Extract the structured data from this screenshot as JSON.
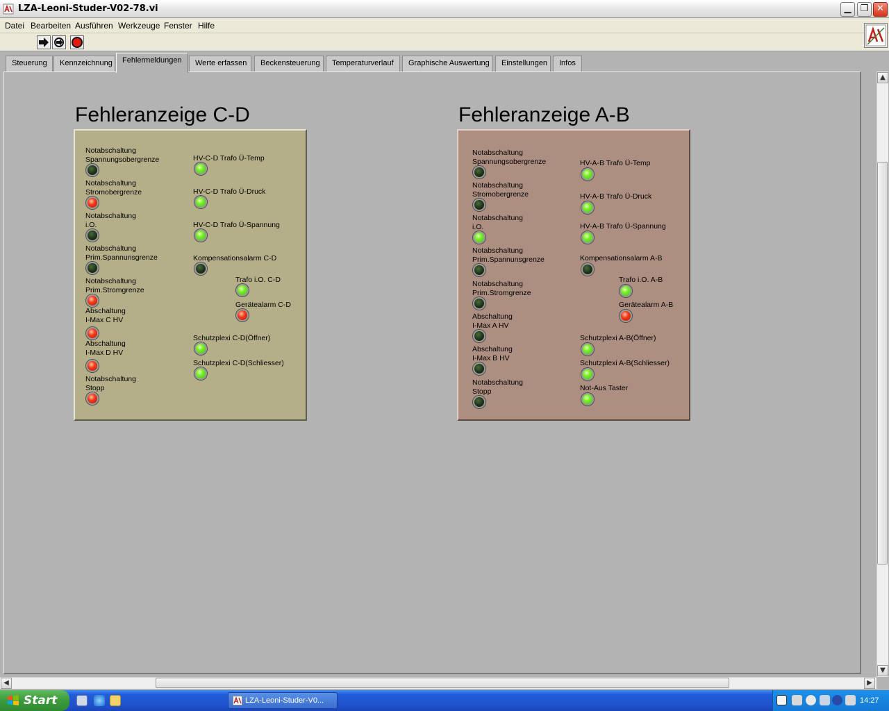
{
  "window": {
    "title": "LZA-Leoni-Studer-V02-78.vi",
    "controls": [
      "minimize",
      "maximize",
      "close"
    ]
  },
  "menu": [
    "Datei",
    "Bearbeiten",
    "Ausführen",
    "Werkzeuge",
    "Fenster",
    "Hilfe"
  ],
  "toolbar": {
    "buttons": [
      "run-arrow-icon",
      "run-continuously-icon",
      "abort-stop-icon"
    ]
  },
  "tabs": [
    {
      "label": "Steuerung",
      "active": false
    },
    {
      "label": "Kennzeichnung",
      "active": false
    },
    {
      "label": "Fehlermeldungen",
      "active": true
    },
    {
      "label": "Werte erfassen",
      "active": false
    },
    {
      "label": "Beckensteuerung",
      "active": false
    },
    {
      "label": "Temperaturverlauf",
      "active": false
    },
    {
      "label": "Graphische Auswertung",
      "active": false
    },
    {
      "label": "Einstellungen",
      "active": false
    },
    {
      "label": "Infos",
      "active": false
    }
  ],
  "panel_cd": {
    "title": "Fehleranzeige C-D",
    "left": [
      {
        "label": "Notabschaltung\nSpannungsobergrenze",
        "state": "off"
      },
      {
        "label": "Notabschaltung\nStromobergrenze",
        "state": "red"
      },
      {
        "label": "Notabschaltung\ni.O.",
        "state": "off"
      },
      {
        "label": "Notabschaltung\nPrim.Spannunsgrenze",
        "state": "off"
      },
      {
        "label": "Notabschaltung\nPrim.Stromgrenze",
        "state": "red"
      },
      {
        "label": "Abschaltung\nI-Max C HV",
        "state": "red"
      },
      {
        "label": "Abschaltung\nI-Max D HV",
        "state": "red"
      },
      {
        "label": "Notabschaltung\nStopp",
        "state": "red"
      }
    ],
    "right": [
      {
        "label": "HV-C-D Trafo Ü-Temp",
        "state": "green"
      },
      {
        "label": "HV-C-D Trafo Ü-Druck",
        "state": "green"
      },
      {
        "label": "HV-C-D Trafo Ü-Spannung",
        "state": "green"
      },
      {
        "label": "Kompensationsalarm C-D",
        "state": "off"
      },
      {
        "label": "Trafo i.O. C-D",
        "state": "green"
      },
      {
        "label": "Gerätealarm C-D",
        "state": "red"
      },
      {
        "label": "Schutzplexi C-D(Öffner)",
        "state": "green"
      },
      {
        "label": "Schutzplexi C-D(Schliesser)",
        "state": "green"
      }
    ]
  },
  "panel_ab": {
    "title": "Fehleranzeige A-B",
    "left": [
      {
        "label": "Notabschaltung\nSpannungsobergrenze",
        "state": "off"
      },
      {
        "label": "Notabschaltung\nStromobergrenze",
        "state": "off"
      },
      {
        "label": "Notabschaltung\ni.O.",
        "state": "green"
      },
      {
        "label": "Notabschaltung\nPrim.Spannunsgrenze",
        "state": "off"
      },
      {
        "label": "Notabschaltung\nPrim.Stromgrenze",
        "state": "off"
      },
      {
        "label": "Abschaltung\nI-Max A HV",
        "state": "off"
      },
      {
        "label": "Abschaltung\nI-Max B HV",
        "state": "off"
      },
      {
        "label": "Notabschaltung\nStopp",
        "state": "off"
      }
    ],
    "right": [
      {
        "label": "HV-A-B Trafo Ü-Temp",
        "state": "green"
      },
      {
        "label": "HV-A-B Trafo Ü-Druck",
        "state": "green"
      },
      {
        "label": "HV-A-B Trafo Ü-Spannung",
        "state": "green"
      },
      {
        "label": "Kompensationsalarm A-B",
        "state": "off"
      },
      {
        "label": "Trafo i.O. A-B",
        "state": "green"
      },
      {
        "label": "Gerätealarm A-B",
        "state": "red"
      },
      {
        "label": "Schutzplexi A-B(Öffner)",
        "state": "green"
      },
      {
        "label": "Schutzplexi A-B(Schliesser)",
        "state": "green"
      },
      {
        "label": "Not-Aus Taster",
        "state": "green"
      }
    ]
  },
  "taskbar": {
    "start_label": "Start",
    "tasks": [
      "LZA-Leoni-Studer-V0..."
    ],
    "clock": "14:27"
  },
  "colors": {
    "panel_cd_bg": "#b4af89",
    "panel_ab_bg": "#ad8f82",
    "led_green": "#6ee62a",
    "led_red": "#e8301a",
    "led_off": "#1e3218"
  }
}
